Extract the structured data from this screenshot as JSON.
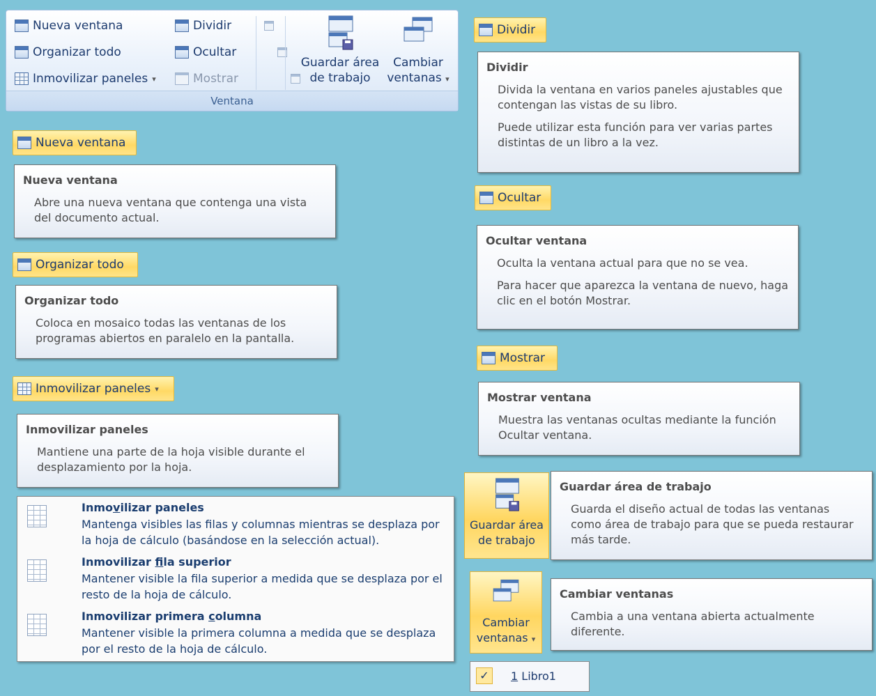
{
  "ribbon": {
    "nueva_ventana": "Nueva ventana",
    "organizar_todo": "Organizar todo",
    "inmovilizar_paneles": "Inmovilizar paneles",
    "dividir": "Dividir",
    "ocultar": "Ocultar",
    "mostrar": "Mostrar",
    "guardar_line1": "Guardar área",
    "guardar_line2": "de trabajo",
    "cambiar_line1": "Cambiar",
    "cambiar_line2": "ventanas",
    "group_label": "Ventana"
  },
  "buttons": {
    "nueva_ventana": "Nueva ventana",
    "organizar_todo": "Organizar todo",
    "inmovilizar_paneles": "Inmovilizar paneles",
    "dividir": "Dividir",
    "ocultar": "Ocultar",
    "mostrar": "Mostrar",
    "guardar_line1": "Guardar área",
    "guardar_line2": "de trabajo",
    "cambiar_line1": "Cambiar",
    "cambiar_line2": "ventanas"
  },
  "tooltips": {
    "nueva_ventana": {
      "title": "Nueva ventana",
      "desc": "Abre una nueva ventana que contenga una vista del documento actual."
    },
    "organizar_todo": {
      "title": "Organizar todo",
      "desc": "Coloca en mosaico todas las ventanas de los programas abiertos en paralelo en la pantalla."
    },
    "inmovilizar_paneles": {
      "title": "Inmovilizar paneles",
      "desc": "Mantiene una parte de la hoja visible durante el desplazamiento por la hoja."
    },
    "dividir": {
      "title": "Dividir",
      "desc1": "Divida la ventana en varios paneles ajustables que contengan las vistas de su libro.",
      "desc2": "Puede utilizar esta función para ver varias partes distintas de un libro a la vez."
    },
    "ocultar": {
      "title": "Ocultar ventana",
      "desc1": "Oculta la ventana actual para que no se vea.",
      "desc2": "Para hacer que aparezca la ventana de nuevo, haga clic en el botón Mostrar."
    },
    "mostrar": {
      "title": "Mostrar ventana",
      "desc": "Muestra las ventanas ocultas mediante la función Ocultar ventana."
    },
    "guardar": {
      "title": "Guardar área de trabajo",
      "desc": "Guarda el diseño actual de todas las ventanas como área de trabajo para que se pueda restaurar más tarde."
    },
    "cambiar": {
      "title": "Cambiar ventanas",
      "desc": "Cambia a una ventana abierta actualmente diferente."
    }
  },
  "menu": {
    "items": [
      {
        "title_pre": "Inmo",
        "title_u": "v",
        "title_post": "ilizar paneles",
        "desc": "Mantenga visibles las filas y columnas mientras se desplaza por la hoja de cálculo (basándose en la selección actual)."
      },
      {
        "title_pre": "Inmovilizar ",
        "title_u": "f",
        "title_post": "ila superior",
        "desc": "Mantener visible la fila superior a medida que se desplaza por el resto de la hoja de cálculo."
      },
      {
        "title_pre": "Inmovilizar primera ",
        "title_u": "c",
        "title_post": "olumna",
        "desc": "Mantener visible la primera columna a medida que se desplaza por el resto de la hoja de cálculo."
      }
    ]
  },
  "window_list": {
    "check": "✓",
    "number": "1",
    "name": " Libro1"
  },
  "icons": {
    "caret": "▾"
  }
}
